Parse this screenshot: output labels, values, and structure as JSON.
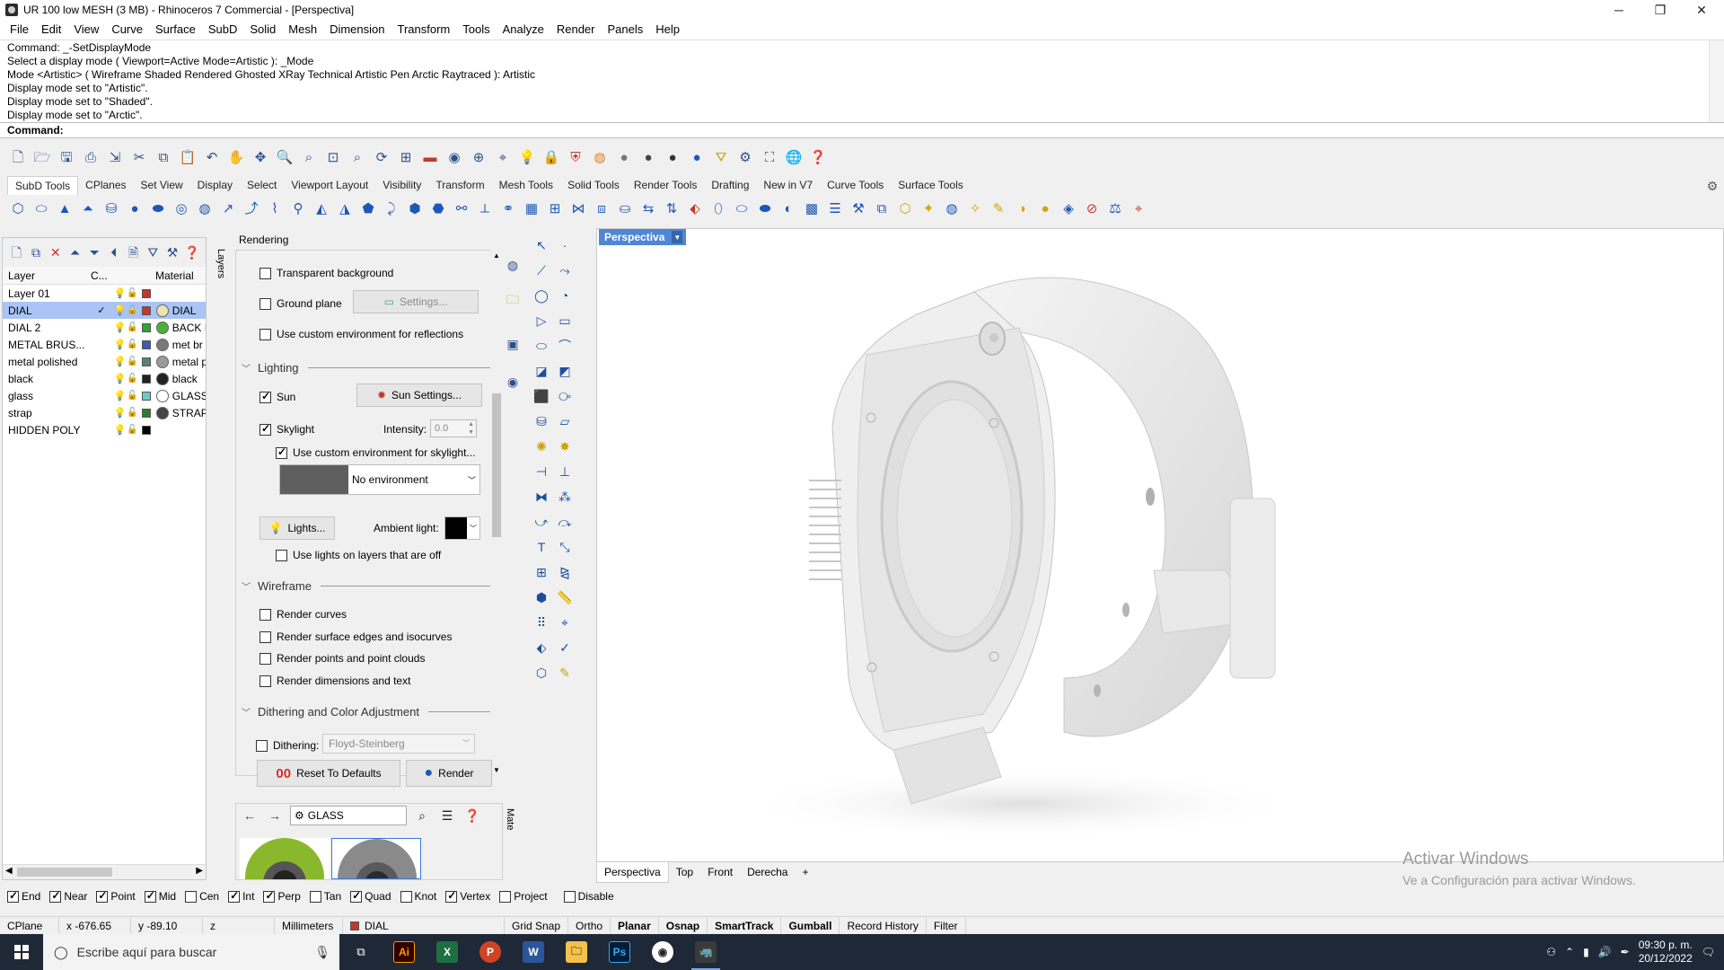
{
  "window": {
    "title": "UR 100 low MESH (3 MB) - Rhinoceros 7 Commercial - [Perspectiva]",
    "minimize": "─",
    "maximize": "❐",
    "close": "✕"
  },
  "menu": [
    "File",
    "Edit",
    "View",
    "Curve",
    "Surface",
    "SubD",
    "Solid",
    "Mesh",
    "Dimension",
    "Transform",
    "Tools",
    "Analyze",
    "Render",
    "Panels",
    "Help"
  ],
  "command_history": [
    "Command: _-SetDisplayMode",
    "Select a display mode ( Viewport=Active  Mode=Artistic ): _Mode",
    "Mode <Artistic> ( Wireframe  Shaded  Rendered  Ghosted  XRay  Technical  Artistic  Pen  Arctic  Raytraced ): Artistic",
    "Display mode set to \"Artistic\".",
    "Display mode set to \"Shaded\".",
    "Display mode set to \"Arctic\"."
  ],
  "command_prompt": "Command:",
  "toolbar_tabs": [
    "SubD Tools",
    "CPlanes",
    "Set View",
    "Display",
    "Select",
    "Viewport Layout",
    "Visibility",
    "Transform",
    "Mesh Tools",
    "Solid Tools",
    "Render Tools",
    "Drafting",
    "New in V7",
    "Curve Tools",
    "Surface Tools"
  ],
  "standard_toolbar_icons": [
    "new-icon",
    "open-icon",
    "save-icon",
    "print-icon",
    "import-icon",
    "cut-icon",
    "copy-icon",
    "paste-icon",
    "undo-icon",
    "pan-icon",
    "rotate-view-icon",
    "zoom-dynamic-icon",
    "zoom-window-icon",
    "zoom-extents-icon",
    "zoom-selected-icon",
    "rotate-icon",
    "four-viewports-icon",
    "car-icon",
    "camera-icon",
    "target-icon",
    "cplane-icon",
    "bulb-icon",
    "lock-icon",
    "shield-icon",
    "color-wheel-icon",
    "shaded-sphere-icon",
    "render-sphere-icon",
    "rendered-sphere-icon",
    "blue-sphere-icon",
    "filter-icon",
    "settings-icon",
    "properties-icon",
    "globe-icon",
    "help-icon"
  ],
  "layers": {
    "headers": {
      "layer": "Layer",
      "current": "C...",
      "material": "Material"
    },
    "rows": [
      {
        "name": "Layer 01",
        "current": "",
        "color": "#c0392b",
        "material": "",
        "mat_color": "",
        "selected": false
      },
      {
        "name": "DIAL",
        "current": "✓",
        "color": "#c0392b",
        "material": "DIAL",
        "mat_color": "#e9e4b0",
        "selected": true
      },
      {
        "name": "DIAL 2",
        "current": "",
        "color": "#2fa43a",
        "material": "BACK I",
        "mat_color": "#4caf3a",
        "selected": false
      },
      {
        "name": "METAL BRUS...",
        "current": "",
        "color": "#3b5bb5",
        "material": "met br",
        "mat_color": "#7a7a7a",
        "selected": false
      },
      {
        "name": "metal polished",
        "current": "",
        "color": "#5b7f7f",
        "material": "metal p",
        "mat_color": "#9a9a9a",
        "selected": false
      },
      {
        "name": "black",
        "current": "",
        "color": "#222222",
        "material": "black",
        "mat_color": "#222222",
        "selected": false
      },
      {
        "name": "glass",
        "current": "",
        "color": "#6cc9c9",
        "material": "GLASS",
        "mat_color": "#ffffff",
        "selected": false
      },
      {
        "name": "strap",
        "current": "",
        "color": "#2e7d32",
        "material": "STRAP",
        "mat_color": "#444444",
        "selected": false
      },
      {
        "name": "HIDDEN POLY",
        "current": "",
        "color": "#000000",
        "material": "",
        "mat_color": "",
        "selected": false
      }
    ],
    "side_tab": "Layers"
  },
  "rendering": {
    "title": "Rendering",
    "transparent_background": "Transparent background",
    "ground_plane": "Ground plane",
    "settings_btn": "Settings...",
    "custom_env_reflections": "Use custom environment for reflections",
    "lighting_header": "Lighting",
    "sun": "Sun",
    "sun_settings_btn": "Sun Settings...",
    "skylight": "Skylight",
    "intensity_label": "Intensity:",
    "intensity_value": "0.0",
    "custom_env_skylight": "Use custom environment for skylight...",
    "environment": "No environment",
    "lights_btn": "Lights...",
    "ambient_label": "Ambient light:",
    "lights_off_layers": "Use lights on layers that are off",
    "wireframe_header": "Wireframe",
    "render_curves": "Render curves",
    "render_edges": "Render surface edges and isocurves",
    "render_points": "Render points and point clouds",
    "render_dims": "Render dimensions and text",
    "dither_header": "Dithering and Color Adjustment",
    "dithering": "Dithering:",
    "dither_method": "Floyd-Steinberg",
    "reset_btn": "Reset To Defaults",
    "render_btn": "Render",
    "checks": {
      "transparent": false,
      "ground": false,
      "env_refl": false,
      "sun": true,
      "skylight": true,
      "env_sky": true,
      "lights_off": false,
      "curves": false,
      "edges": false,
      "points": false,
      "dims": false,
      "dither": false
    }
  },
  "materials": {
    "search_value": "GLASS",
    "side_tab": "Mate"
  },
  "viewport": {
    "label": "Perspectiva",
    "tabs": [
      "Perspectiva",
      "Top",
      "Front",
      "Derecha"
    ],
    "add_tab": "+"
  },
  "watermark": {
    "line1": "Activar Windows",
    "line2": "Ve a Configuración para activar Windows."
  },
  "osnaps": [
    {
      "label": "End",
      "on": true
    },
    {
      "label": "Near",
      "on": true
    },
    {
      "label": "Point",
      "on": true
    },
    {
      "label": "Mid",
      "on": true
    },
    {
      "label": "Cen",
      "on": false
    },
    {
      "label": "Int",
      "on": true
    },
    {
      "label": "Perp",
      "on": true
    },
    {
      "label": "Tan",
      "on": false
    },
    {
      "label": "Quad",
      "on": true
    },
    {
      "label": "Knot",
      "on": false
    },
    {
      "label": "Vertex",
      "on": true
    },
    {
      "label": "Project",
      "on": false
    },
    {
      "label": "Disable",
      "on": false
    }
  ],
  "status": {
    "cplane": "CPlane",
    "x": "x -676.65",
    "y": "y -89.10",
    "z": "z",
    "units": "Millimeters",
    "layer": "DIAL",
    "toggles": [
      "Grid Snap",
      "Ortho",
      "Planar",
      "Osnap",
      "SmartTrack",
      "Gumball",
      "Record History",
      "Filter"
    ],
    "bold_toggles": [
      "Planar",
      "Osnap",
      "SmartTrack",
      "Gumball"
    ]
  },
  "taskbar": {
    "search_placeholder": "Escribe aquí para buscar",
    "time": "09:30 p. m.",
    "date": "20/12/2022"
  }
}
